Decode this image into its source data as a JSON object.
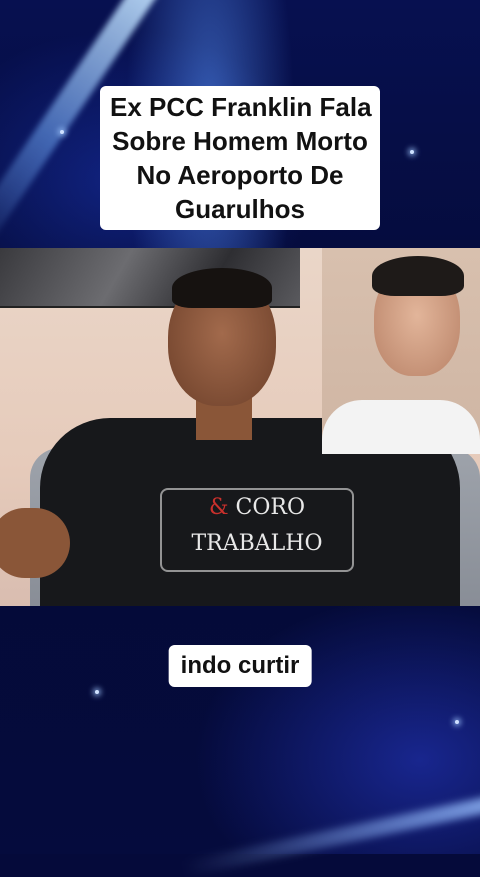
{
  "title_caption": {
    "lines": [
      "Ex PCC Franklin Fala",
      "Sobre Homem Morto",
      "No Aeroporto De",
      "Guarulhos"
    ]
  },
  "subtitle_caption": "indo curtir",
  "video": {
    "shirt_print": {
      "line1": "CORO",
      "line2": "TRABALHO"
    }
  },
  "colors": {
    "background": "#050a3a",
    "caption_bg": "#ffffff",
    "caption_text": "#111111"
  }
}
